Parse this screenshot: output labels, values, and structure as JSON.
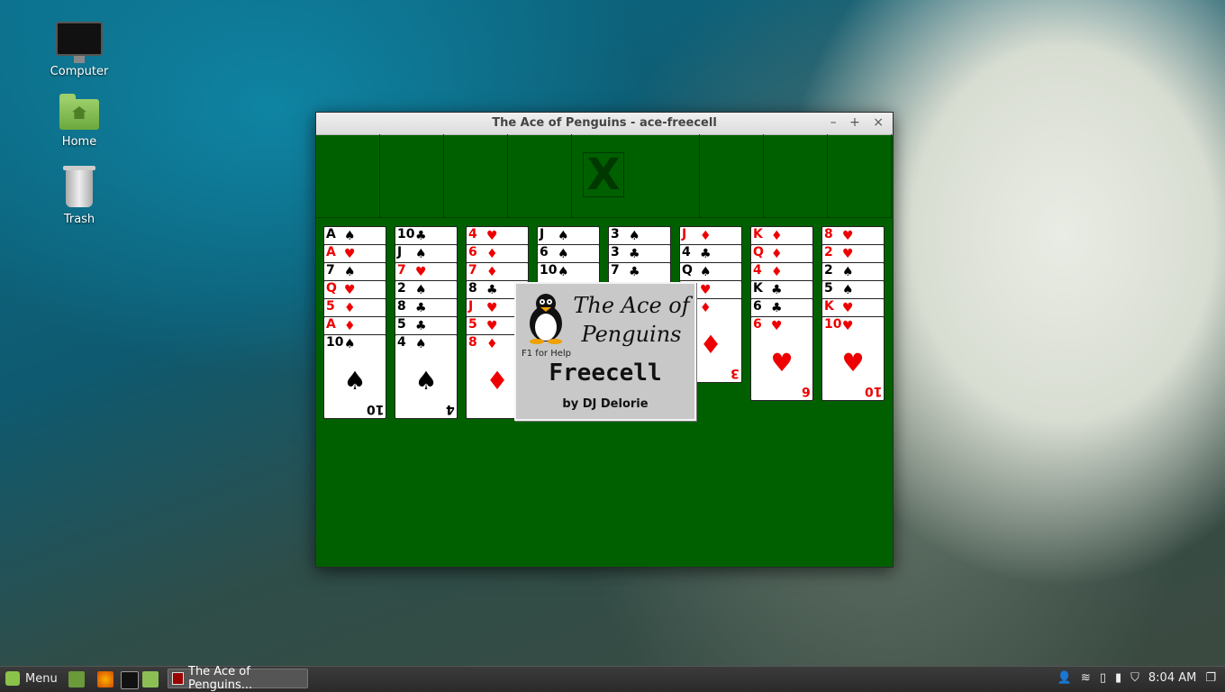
{
  "desktop": {
    "icons": [
      {
        "label": "Computer",
        "icon": "monitor-icon"
      },
      {
        "label": "Home",
        "icon": "home-folder-icon"
      },
      {
        "label": "Trash",
        "icon": "trash-icon"
      }
    ]
  },
  "window": {
    "title": "The Ace of Penguins - ace-freecell",
    "controls": {
      "minimize": "–",
      "maximize": "+",
      "close": "×"
    },
    "home_mark": "X"
  },
  "tableau": [
    [
      {
        "r": "A",
        "s": "♠"
      },
      {
        "r": "A",
        "s": "♥"
      },
      {
        "r": "7",
        "s": "♠"
      },
      {
        "r": "Q",
        "s": "♥"
      },
      {
        "r": "5",
        "s": "♦"
      },
      {
        "r": "A",
        "s": "♦"
      },
      {
        "r": "10",
        "s": "♠"
      }
    ],
    [
      {
        "r": "10",
        "s": "♣"
      },
      {
        "r": "J",
        "s": "♠"
      },
      {
        "r": "7",
        "s": "♥"
      },
      {
        "r": "2",
        "s": "♠"
      },
      {
        "r": "8",
        "s": "♣"
      },
      {
        "r": "5",
        "s": "♣"
      },
      {
        "r": "4",
        "s": "♠"
      }
    ],
    [
      {
        "r": "4",
        "s": "♥"
      },
      {
        "r": "6",
        "s": "♦"
      },
      {
        "r": "7",
        "s": "♦"
      },
      {
        "r": "8",
        "s": "♣"
      },
      {
        "r": "J",
        "s": "♥"
      },
      {
        "r": "5",
        "s": "♥"
      },
      {
        "r": "8",
        "s": "♦"
      }
    ],
    [
      {
        "r": "J",
        "s": "♠"
      },
      {
        "r": "6",
        "s": "♠"
      },
      {
        "r": "10",
        "s": "♠"
      }
    ],
    [
      {
        "r": "3",
        "s": "♠"
      },
      {
        "r": "3",
        "s": "♣"
      },
      {
        "r": "7",
        "s": "♣"
      }
    ],
    [
      {
        "r": "J",
        "s": "♦"
      },
      {
        "r": "4",
        "s": "♣"
      },
      {
        "r": "Q",
        "s": "♠"
      },
      {
        "r": "3",
        "s": "♥"
      },
      {
        "r": "3",
        "s": "♦"
      }
    ],
    [
      {
        "r": "K",
        "s": "♦"
      },
      {
        "r": "Q",
        "s": "♦"
      },
      {
        "r": "4",
        "s": "♦"
      },
      {
        "r": "K",
        "s": "♣"
      },
      {
        "r": "6",
        "s": "♣"
      },
      {
        "r": "6",
        "s": "♥"
      }
    ],
    [
      {
        "r": "8",
        "s": "♥"
      },
      {
        "r": "2",
        "s": "♥"
      },
      {
        "r": "2",
        "s": "♠"
      },
      {
        "r": "5",
        "s": "♠"
      },
      {
        "r": "K",
        "s": "♥"
      },
      {
        "r": "10",
        "s": "♥"
      }
    ]
  ],
  "splash": {
    "title": "The Ace of Penguins",
    "help": "F1 for Help",
    "game": "Freecell",
    "author": "by DJ Delorie"
  },
  "taskbar": {
    "menu_label": "Menu",
    "task_label": "The Ace of Penguins...",
    "clock": "8:04 AM"
  }
}
